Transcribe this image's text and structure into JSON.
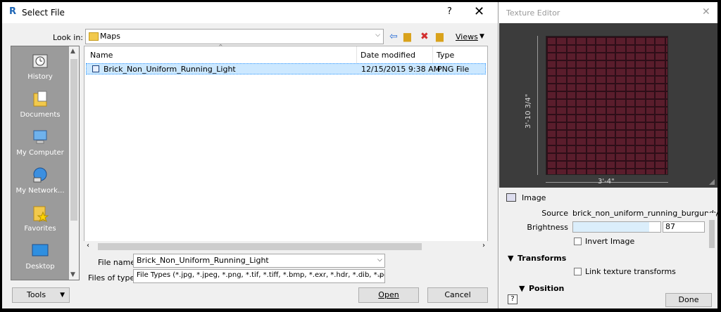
{
  "select_file": {
    "title": "Select File",
    "app_icon": "R",
    "help": "?",
    "close": "✕",
    "look_in_label": "Look in:",
    "look_in_value": "Maps",
    "views_label": "Views",
    "toolbar_icons": [
      "back-arrow-icon",
      "up-folder-icon",
      "delete-icon",
      "new-folder-icon"
    ],
    "places": [
      {
        "label": "History",
        "icon": "history-icon"
      },
      {
        "label": "Documents",
        "icon": "documents-icon"
      },
      {
        "label": "My Computer",
        "icon": "computer-icon"
      },
      {
        "label": "My Network...",
        "icon": "network-icon"
      },
      {
        "label": "Favorites",
        "icon": "favorites-icon"
      },
      {
        "label": "Desktop",
        "icon": "desktop-icon"
      }
    ],
    "columns": {
      "name": "Name",
      "date": "Date modified",
      "type": "Type"
    },
    "files": [
      {
        "name": "Brick_Non_Uniform_Running_Light",
        "date": "12/15/2015 9:38 AM",
        "type": "PNG File"
      }
    ],
    "file_name_label": "File name:",
    "file_name_value": "Brick_Non_Uniform_Running_Light",
    "file_types_label": "Files of type:",
    "file_types_value": "File Types (*.jpg, *.jpeg, *.png, *.tif, *.tiff, *.bmp, *.exr, *.hdr, *.dib, *.pc",
    "tools_label": "Tools",
    "open_label": "Open",
    "cancel_label": "Cancel"
  },
  "texture_editor": {
    "title": "Texture Editor",
    "close": "✕",
    "height_dim": "3'-10 3/4\"",
    "width_dim": "3'-4\"",
    "section": "Image",
    "source_label": "Source",
    "source_value": "brick_non_uniform_running_burgundy.p",
    "brightness_label": "Brightness",
    "brightness_value": "87",
    "brightness_level": 0.87,
    "invert_label": "Invert Image",
    "transforms_label": "Transforms",
    "link_label": "Link texture transforms",
    "position_label": "Position",
    "help_icon": "?",
    "done_label": "Done"
  }
}
